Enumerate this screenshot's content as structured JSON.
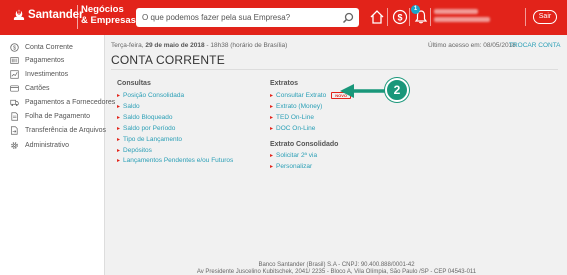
{
  "header": {
    "logo_text": "Santander",
    "sub_line1": "Negócios",
    "sub_line2": "& Empresas",
    "search_placeholder": "O que podemos fazer pela sua Empresa?",
    "notification_count": "1",
    "exit_label": "Sair",
    "brand_color": "#e2231a"
  },
  "sidebar": {
    "items": [
      {
        "label": "Conta Corrente",
        "icon": "dollar-circle-icon"
      },
      {
        "label": "Pagamentos",
        "icon": "barcode-icon"
      },
      {
        "label": "Investimentos",
        "icon": "chart-icon"
      },
      {
        "label": "Cartões",
        "icon": "card-icon"
      },
      {
        "label": "Pagamentos a Fornecedores",
        "icon": "supplier-icon"
      },
      {
        "label": "Folha de Pagamento",
        "icon": "payroll-icon"
      },
      {
        "label": "Transferência de Arquivos",
        "icon": "file-transfer-icon"
      },
      {
        "label": "Administrativo",
        "icon": "gear-icon"
      }
    ]
  },
  "main": {
    "date_prefix": "Terça-feira,",
    "date_bold": "29 de maio de 2018",
    "date_suffix": "- 18h38 (horário de Brasília)",
    "last_access": "Último acesso em: 08/05/2018",
    "change_account": "TROCAR CONTA",
    "title": "CONTA CORRENTE",
    "consultas": {
      "title": "Consultas",
      "links": [
        "Posição Consolidada",
        "Saldo",
        "Saldo Bloqueado",
        "Saldo por Período",
        "Tipo de Lançamento",
        "Depósitos",
        "Lançamentos Pendentes e/ou Futuros"
      ]
    },
    "extratos": {
      "title": "Extratos",
      "links": [
        "Consultar Extrato",
        "Extrato (Money)",
        "TED On-Line",
        "DOC On-Line"
      ],
      "new_badge": "NOVO"
    },
    "extrato_consolidado": {
      "title": "Extrato Consolidado",
      "links": [
        "Solicitar 2ª via",
        "Personalizar"
      ]
    },
    "annotation_number": "2",
    "annotation_color": "#19977a",
    "link_color": "#2a9fb6"
  },
  "footer": {
    "line1": "Banco Santander (Brasil) S.A - CNPJ: 90.400.888/0001-42",
    "line2": "Av Presidente Juscelino Kubitschek, 2041/ 2235 - Bloco A, Vila Olímpia, São Paulo /SP - CEP 04543-011"
  }
}
